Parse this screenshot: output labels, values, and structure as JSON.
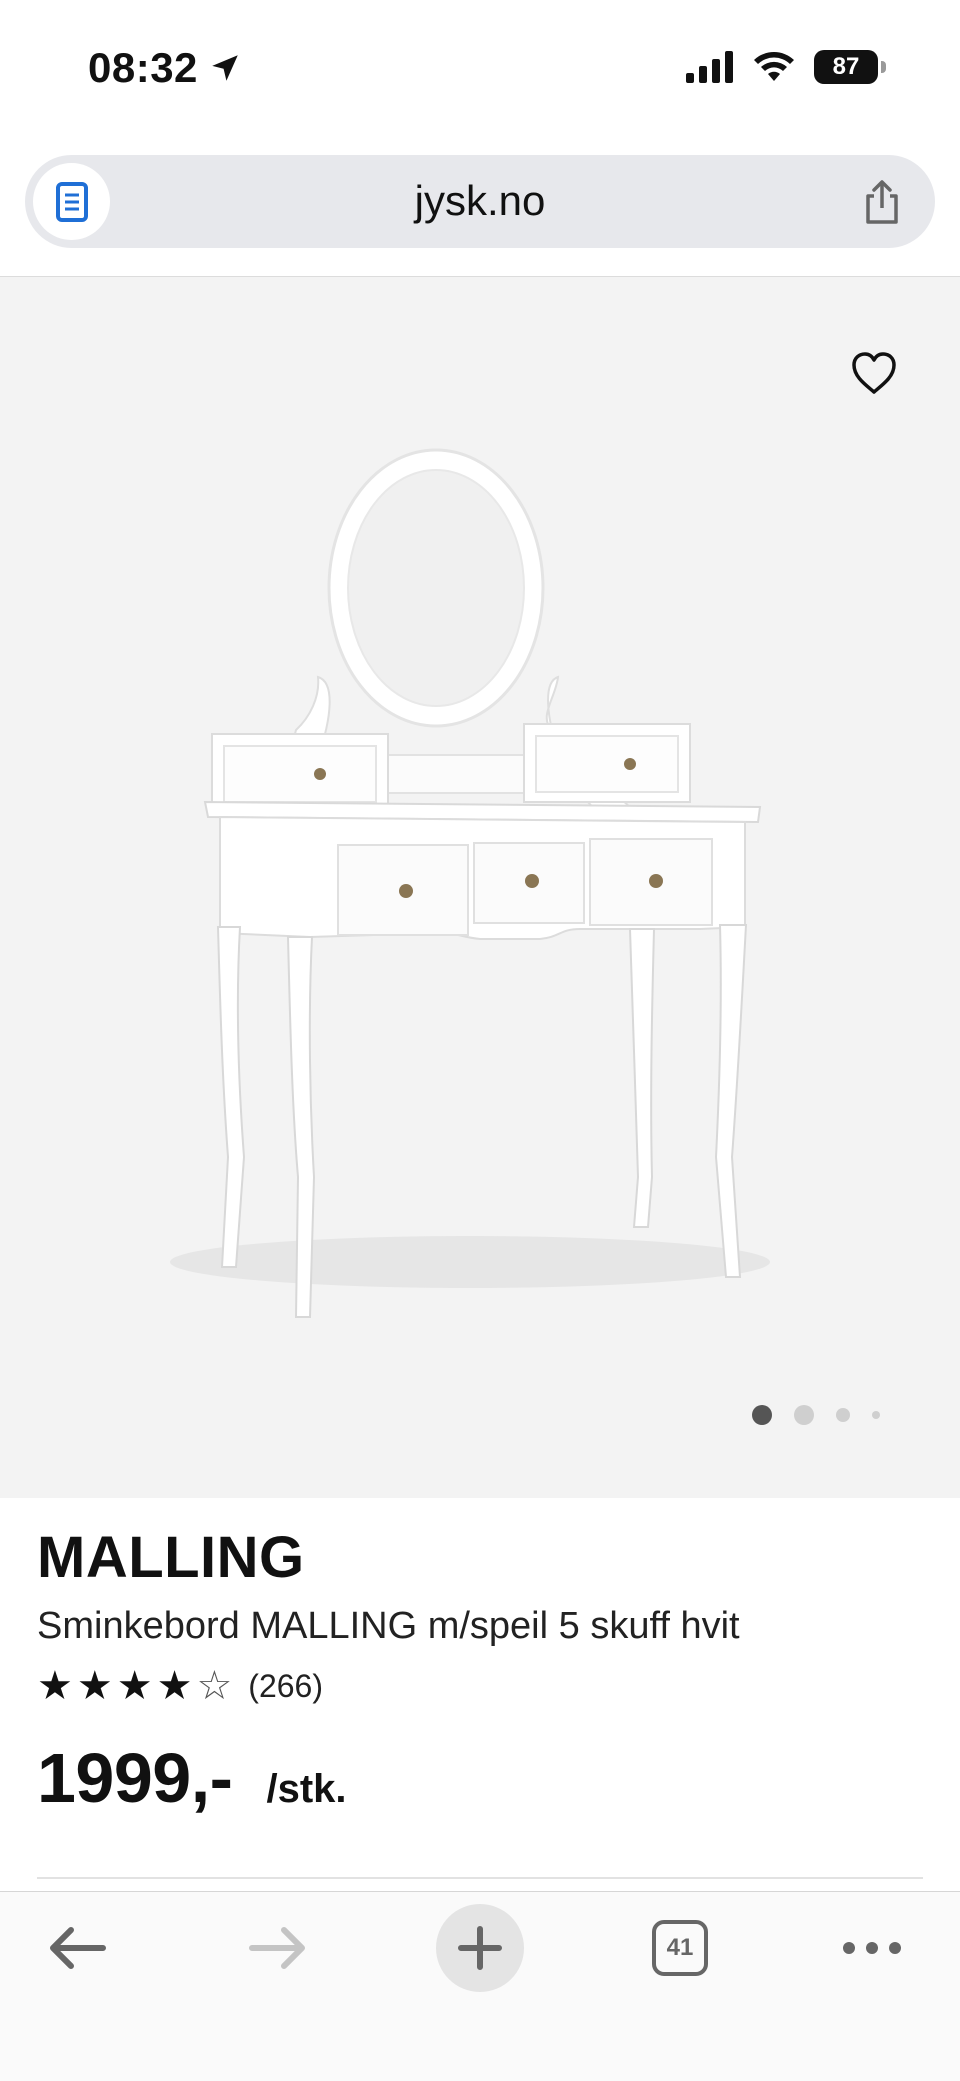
{
  "status_bar": {
    "time": "08:32",
    "battery": "87"
  },
  "browser": {
    "url": "jysk.no",
    "tab_count": "41"
  },
  "product": {
    "brand": "MALLING",
    "description": "Sminkebord MALLING m/speil 5 skuff hvit",
    "rating_value": 4,
    "rating_max": 5,
    "review_count": "(266)",
    "price": "1999,-",
    "unit": "/stk.",
    "image_count": 4,
    "active_image": 1,
    "icons": [
      "favorite-heart-icon",
      "star-icon"
    ]
  },
  "colors": {
    "accent": "#1f6fd6",
    "text": "#111111",
    "image_bg": "#f3f3f3"
  }
}
